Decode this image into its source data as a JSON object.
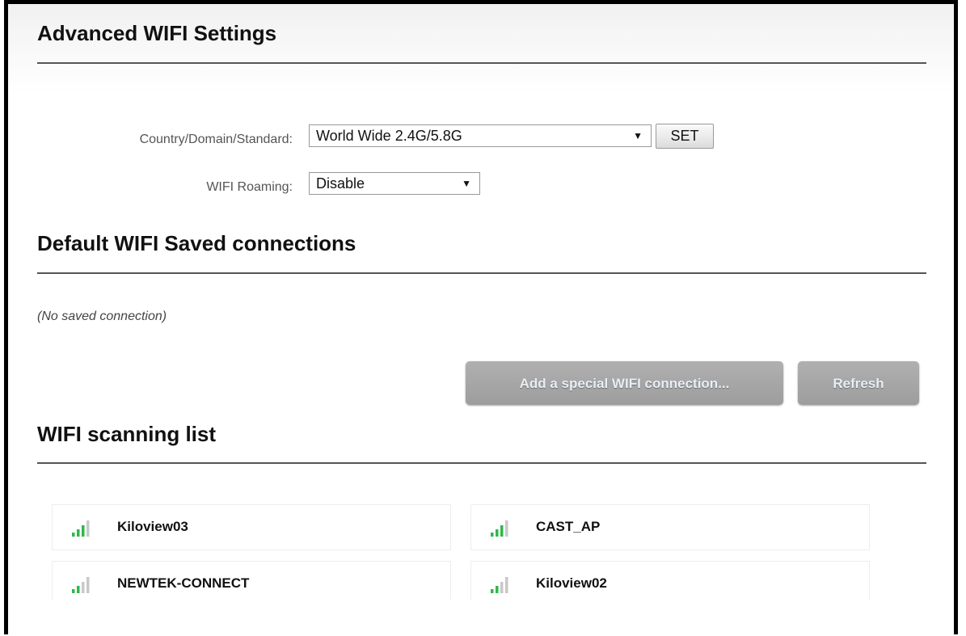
{
  "advanced": {
    "title": "Advanced WIFI Settings",
    "country_label": "Country/Domain/Standard:",
    "country_value": "World Wide 2.4G/5.8G",
    "set_label": "SET",
    "roaming_label": "WIFI Roaming:",
    "roaming_value": "Disable",
    "dropdown_arrow": "▼"
  },
  "saved": {
    "title": "Default WIFI Saved connections",
    "empty_text": "(No saved connection)",
    "add_button": "Add a special WIFI connection...",
    "refresh_button": "Refresh"
  },
  "scanning": {
    "title": "WIFI scanning list",
    "networks": [
      {
        "ssid": "Kiloview03",
        "signal_bars": 3,
        "icon": "wifi-signal-icon"
      },
      {
        "ssid": "CAST_AP",
        "signal_bars": 3,
        "icon": "wifi-signal-icon"
      },
      {
        "ssid": "NEWTEK-CONNECT",
        "signal_bars": 2,
        "icon": "wifi-signal-icon"
      },
      {
        "ssid": "Kiloview02",
        "signal_bars": 2,
        "icon": "wifi-signal-icon"
      }
    ]
  },
  "colors": {
    "signal_active": "#2fb84a",
    "signal_inactive": "#c8c8c8",
    "button_gray": "#a6a6a6"
  }
}
